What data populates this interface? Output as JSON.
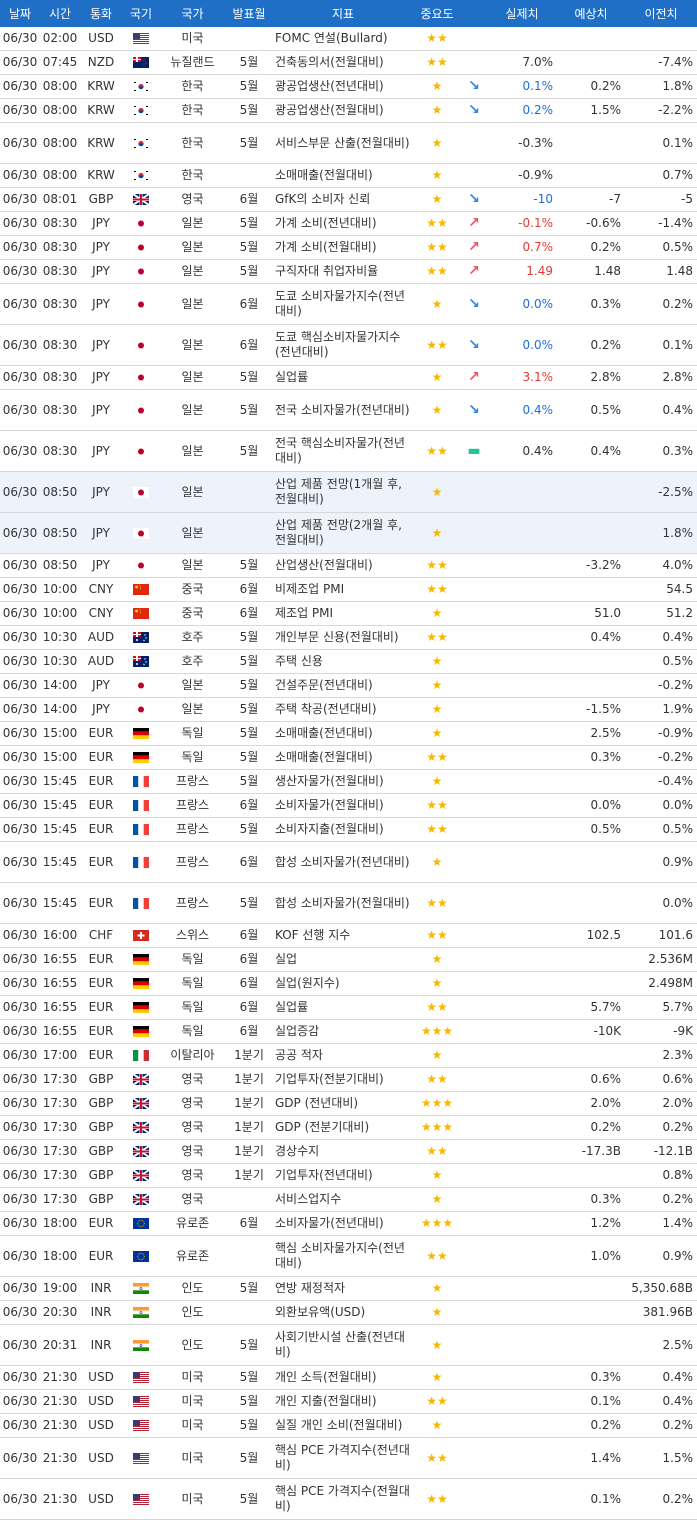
{
  "columns": [
    "날짜",
    "시간",
    "통화",
    "국기",
    "국가",
    "발표월",
    "지표",
    "중요도",
    "",
    "실제치",
    "예상치",
    "이전치"
  ],
  "flag_colors": {
    "US": "#b22234",
    "NZ": "#012169",
    "KR": "#ffffff",
    "GB": "#012169",
    "JP": "#ffffff",
    "CN": "#de2910",
    "AU": "#012169",
    "DE": "#000000",
    "FR": "#0055a4",
    "CH": "#d52b1e",
    "IT": "#009246",
    "EU": "#003399",
    "IN": "#ff9933"
  },
  "rows": [
    {
      "date": "06/30",
      "time": "02:00",
      "cur": "USD",
      "flag": "US",
      "country": "미국",
      "month": "",
      "indicator": "FOMC 연설(Bullard)",
      "stars": "★★",
      "trend": "",
      "actual": "",
      "forecast": "",
      "previous": ""
    },
    {
      "date": "06/30",
      "time": "07:45",
      "cur": "NZD",
      "flag": "NZ",
      "country": "뉴질랜드",
      "month": "5월",
      "indicator": "건축동의서(전월대비)",
      "stars": "★★",
      "trend": "",
      "actual": "7.0%",
      "forecast": "",
      "previous": "-7.4%"
    },
    {
      "date": "06/30",
      "time": "08:00",
      "cur": "KRW",
      "flag": "KR",
      "country": "한국",
      "month": "5월",
      "indicator": "광공업생산(전년대비)",
      "stars": "★",
      "trend": "dn",
      "actual": "0.1%",
      "forecast": "0.2%",
      "previous": "1.8%"
    },
    {
      "date": "06/30",
      "time": "08:00",
      "cur": "KRW",
      "flag": "KR",
      "country": "한국",
      "month": "5월",
      "indicator": "광공업생산(전월대비)",
      "stars": "★",
      "trend": "dn",
      "actual": "0.2%",
      "forecast": "1.5%",
      "previous": "-2.2%"
    },
    {
      "date": "06/30",
      "time": "08:00",
      "cur": "KRW",
      "flag": "KR",
      "country": "한국",
      "month": "5월",
      "indicator": "서비스부문 산출(전월대비)",
      "stars": "★",
      "trend": "",
      "actual": "-0.3%",
      "forecast": "",
      "previous": "0.1%"
    },
    {
      "date": "06/30",
      "time": "08:00",
      "cur": "KRW",
      "flag": "KR",
      "country": "한국",
      "month": "",
      "indicator": "소매매출(전월대비)",
      "stars": "★",
      "trend": "",
      "actual": "-0.9%",
      "forecast": "",
      "previous": "0.7%"
    },
    {
      "date": "06/30",
      "time": "08:01",
      "cur": "GBP",
      "flag": "GB",
      "country": "영국",
      "month": "6월",
      "indicator": "GfK의 소비자 신뢰",
      "stars": "★",
      "trend": "dn",
      "actual": "-10",
      "forecast": "-7",
      "previous": "-5"
    },
    {
      "date": "06/30",
      "time": "08:30",
      "cur": "JPY",
      "flag": "JP",
      "country": "일본",
      "month": "5월",
      "indicator": "가계 소비(전년대비)",
      "stars": "★★",
      "trend": "up",
      "actual": "-0.1%",
      "forecast": "-0.6%",
      "previous": "-1.4%"
    },
    {
      "date": "06/30",
      "time": "08:30",
      "cur": "JPY",
      "flag": "JP",
      "country": "일본",
      "month": "5월",
      "indicator": "가계 소비(전월대비)",
      "stars": "★★",
      "trend": "up",
      "actual": "0.7%",
      "forecast": "0.2%",
      "previous": "0.5%"
    },
    {
      "date": "06/30",
      "time": "08:30",
      "cur": "JPY",
      "flag": "JP",
      "country": "일본",
      "month": "5월",
      "indicator": "구직자대 취업자비율",
      "stars": "★★",
      "trend": "up",
      "actual": "1.49",
      "forecast": "1.48",
      "previous": "1.48"
    },
    {
      "date": "06/30",
      "time": "08:30",
      "cur": "JPY",
      "flag": "JP",
      "country": "일본",
      "month": "6월",
      "indicator": "도쿄 소비자물가지수(전년대비)",
      "stars": "★",
      "trend": "dn",
      "actual": "0.0%",
      "forecast": "0.3%",
      "previous": "0.2%"
    },
    {
      "date": "06/30",
      "time": "08:30",
      "cur": "JPY",
      "flag": "JP",
      "country": "일본",
      "month": "6월",
      "indicator": "도쿄 핵심소비자물가지수(전년대비)",
      "stars": "★★",
      "trend": "dn",
      "actual": "0.0%",
      "forecast": "0.2%",
      "previous": "0.1%"
    },
    {
      "date": "06/30",
      "time": "08:30",
      "cur": "JPY",
      "flag": "JP",
      "country": "일본",
      "month": "5월",
      "indicator": "실업률",
      "stars": "★",
      "trend": "up",
      "actual": "3.1%",
      "forecast": "2.8%",
      "previous": "2.8%"
    },
    {
      "date": "06/30",
      "time": "08:30",
      "cur": "JPY",
      "flag": "JP",
      "country": "일본",
      "month": "5월",
      "indicator": "전국 소비자물가(전년대비)",
      "stars": "★",
      "trend": "dn",
      "actual": "0.4%",
      "forecast": "0.5%",
      "previous": "0.4%"
    },
    {
      "date": "06/30",
      "time": "08:30",
      "cur": "JPY",
      "flag": "JP",
      "country": "일본",
      "month": "5월",
      "indicator": "전국 핵심소비자물가(전년대비)",
      "stars": "★★",
      "trend": "eq",
      "actual": "0.4%",
      "forecast": "0.4%",
      "previous": "0.3%"
    },
    {
      "date": "06/30",
      "time": "08:50",
      "cur": "JPY",
      "flag": "JP",
      "country": "일본",
      "month": "",
      "indicator": "산업 제품 전망(1개월 후, 전월대비)",
      "stars": "★",
      "trend": "",
      "actual": "",
      "forecast": "",
      "previous": "-2.5%"
    },
    {
      "date": "06/30",
      "time": "08:50",
      "cur": "JPY",
      "flag": "JP",
      "country": "일본",
      "month": "",
      "indicator": "산업 제품 전망(2개월 후, 전월대비)",
      "stars": "★",
      "trend": "",
      "actual": "",
      "forecast": "",
      "previous": "1.8%"
    },
    {
      "date": "06/30",
      "time": "08:50",
      "cur": "JPY",
      "flag": "JP",
      "country": "일본",
      "month": "5월",
      "indicator": "산업생산(전월대비)",
      "stars": "★★",
      "trend": "",
      "actual": "",
      "forecast": "-3.2%",
      "previous": "4.0%"
    },
    {
      "date": "06/30",
      "time": "10:00",
      "cur": "CNY",
      "flag": "CN",
      "country": "중국",
      "month": "6월",
      "indicator": "비제조업 PMI",
      "stars": "★★",
      "trend": "",
      "actual": "",
      "forecast": "",
      "previous": "54.5"
    },
    {
      "date": "06/30",
      "time": "10:00",
      "cur": "CNY",
      "flag": "CN",
      "country": "중국",
      "month": "6월",
      "indicator": "제조업 PMI",
      "stars": "★",
      "trend": "",
      "actual": "",
      "forecast": "51.0",
      "previous": "51.2"
    },
    {
      "date": "06/30",
      "time": "10:30",
      "cur": "AUD",
      "flag": "AU",
      "country": "호주",
      "month": "5월",
      "indicator": "개인부문 신용(전월대비)",
      "stars": "★★",
      "trend": "",
      "actual": "",
      "forecast": "0.4%",
      "previous": "0.4%"
    },
    {
      "date": "06/30",
      "time": "10:30",
      "cur": "AUD",
      "flag": "AU",
      "country": "호주",
      "month": "5월",
      "indicator": "주택 신용",
      "stars": "★",
      "trend": "",
      "actual": "",
      "forecast": "",
      "previous": "0.5%"
    },
    {
      "date": "06/30",
      "time": "14:00",
      "cur": "JPY",
      "flag": "JP",
      "country": "일본",
      "month": "5월",
      "indicator": "건설주문(전년대비)",
      "stars": "★",
      "trend": "",
      "actual": "",
      "forecast": "",
      "previous": "-0.2%"
    },
    {
      "date": "06/30",
      "time": "14:00",
      "cur": "JPY",
      "flag": "JP",
      "country": "일본",
      "month": "5월",
      "indicator": "주택 착공(전년대비)",
      "stars": "★",
      "trend": "",
      "actual": "",
      "forecast": "-1.5%",
      "previous": "1.9%"
    },
    {
      "date": "06/30",
      "time": "15:00",
      "cur": "EUR",
      "flag": "DE",
      "country": "독일",
      "month": "5월",
      "indicator": "소매매출(전년대비)",
      "stars": "★",
      "trend": "",
      "actual": "",
      "forecast": "2.5%",
      "previous": "-0.9%"
    },
    {
      "date": "06/30",
      "time": "15:00",
      "cur": "EUR",
      "flag": "DE",
      "country": "독일",
      "month": "5월",
      "indicator": "소매매출(전월대비)",
      "stars": "★★",
      "trend": "",
      "actual": "",
      "forecast": "0.3%",
      "previous": "-0.2%"
    },
    {
      "date": "06/30",
      "time": "15:45",
      "cur": "EUR",
      "flag": "FR",
      "country": "프랑스",
      "month": "5월",
      "indicator": "생산자물가(전월대비)",
      "stars": "★",
      "trend": "",
      "actual": "",
      "forecast": "",
      "previous": "-0.4%"
    },
    {
      "date": "06/30",
      "time": "15:45",
      "cur": "EUR",
      "flag": "FR",
      "country": "프랑스",
      "month": "6월",
      "indicator": "소비자물가(전월대비)",
      "stars": "★★",
      "trend": "",
      "actual": "",
      "forecast": "0.0%",
      "previous": "0.0%"
    },
    {
      "date": "06/30",
      "time": "15:45",
      "cur": "EUR",
      "flag": "FR",
      "country": "프랑스",
      "month": "5월",
      "indicator": "소비자지출(전월대비)",
      "stars": "★★",
      "trend": "",
      "actual": "",
      "forecast": "0.5%",
      "previous": "0.5%"
    },
    {
      "date": "06/30",
      "time": "15:45",
      "cur": "EUR",
      "flag": "FR",
      "country": "프랑스",
      "month": "6월",
      "indicator": "합성 소비자물가(전년대비)",
      "stars": "★",
      "trend": "",
      "actual": "",
      "forecast": "",
      "previous": "0.9%"
    },
    {
      "date": "06/30",
      "time": "15:45",
      "cur": "EUR",
      "flag": "FR",
      "country": "프랑스",
      "month": "5월",
      "indicator": "합성 소비자물가(전월대비)",
      "stars": "★★",
      "trend": "",
      "actual": "",
      "forecast": "",
      "previous": "0.0%"
    },
    {
      "date": "06/30",
      "time": "16:00",
      "cur": "CHF",
      "flag": "CH",
      "country": "스위스",
      "month": "6월",
      "indicator": "KOF 선행 지수",
      "stars": "★★",
      "trend": "",
      "actual": "",
      "forecast": "102.5",
      "previous": "101.6"
    },
    {
      "date": "06/30",
      "time": "16:55",
      "cur": "EUR",
      "flag": "DE",
      "country": "독일",
      "month": "6월",
      "indicator": "실업",
      "stars": "★",
      "trend": "",
      "actual": "",
      "forecast": "",
      "previous": "2.536M"
    },
    {
      "date": "06/30",
      "time": "16:55",
      "cur": "EUR",
      "flag": "DE",
      "country": "독일",
      "month": "6월",
      "indicator": "실업(원지수)",
      "stars": "★",
      "trend": "",
      "actual": "",
      "forecast": "",
      "previous": "2.498M"
    },
    {
      "date": "06/30",
      "time": "16:55",
      "cur": "EUR",
      "flag": "DE",
      "country": "독일",
      "month": "6월",
      "indicator": "실업률",
      "stars": "★★",
      "trend": "",
      "actual": "",
      "forecast": "5.7%",
      "previous": "5.7%"
    },
    {
      "date": "06/30",
      "time": "16:55",
      "cur": "EUR",
      "flag": "DE",
      "country": "독일",
      "month": "6월",
      "indicator": "실업증감",
      "stars": "★★★",
      "trend": "",
      "actual": "",
      "forecast": "-10K",
      "previous": "-9K"
    },
    {
      "date": "06/30",
      "time": "17:00",
      "cur": "EUR",
      "flag": "IT",
      "country": "이탈리아",
      "month": "1분기",
      "indicator": "공공 적자",
      "stars": "★",
      "trend": "",
      "actual": "",
      "forecast": "",
      "previous": "2.3%"
    },
    {
      "date": "06/30",
      "time": "17:30",
      "cur": "GBP",
      "flag": "GB",
      "country": "영국",
      "month": "1분기",
      "indicator": "기업투자(전분기대비)",
      "stars": "★★",
      "trend": "",
      "actual": "",
      "forecast": "0.6%",
      "previous": "0.6%"
    },
    {
      "date": "06/30",
      "time": "17:30",
      "cur": "GBP",
      "flag": "GB",
      "country": "영국",
      "month": "1분기",
      "indicator": "GDP (전년대비)",
      "stars": "★★★",
      "trend": "",
      "actual": "",
      "forecast": "2.0%",
      "previous": "2.0%"
    },
    {
      "date": "06/30",
      "time": "17:30",
      "cur": "GBP",
      "flag": "GB",
      "country": "영국",
      "month": "1분기",
      "indicator": "GDP (전분기대비)",
      "stars": "★★★",
      "trend": "",
      "actual": "",
      "forecast": "0.2%",
      "previous": "0.2%"
    },
    {
      "date": "06/30",
      "time": "17:30",
      "cur": "GBP",
      "flag": "GB",
      "country": "영국",
      "month": "1분기",
      "indicator": "경상수지",
      "stars": "★★",
      "trend": "",
      "actual": "",
      "forecast": "-17.3B",
      "previous": "-12.1B"
    },
    {
      "date": "06/30",
      "time": "17:30",
      "cur": "GBP",
      "flag": "GB",
      "country": "영국",
      "month": "1분기",
      "indicator": "기업투자(전년대비)",
      "stars": "★",
      "trend": "",
      "actual": "",
      "forecast": "",
      "previous": "0.8%"
    },
    {
      "date": "06/30",
      "time": "17:30",
      "cur": "GBP",
      "flag": "GB",
      "country": "영국",
      "month": "",
      "indicator": "서비스업지수",
      "stars": "★",
      "trend": "",
      "actual": "",
      "forecast": "0.3%",
      "previous": "0.2%"
    },
    {
      "date": "06/30",
      "time": "18:00",
      "cur": "EUR",
      "flag": "EU",
      "country": "유로존",
      "month": "6월",
      "indicator": "소비자물가(전년대비)",
      "stars": "★★★",
      "trend": "",
      "actual": "",
      "forecast": "1.2%",
      "previous": "1.4%"
    },
    {
      "date": "06/30",
      "time": "18:00",
      "cur": "EUR",
      "flag": "EU",
      "country": "유로존",
      "month": "",
      "indicator": "핵심 소비자물가지수(전년대비)",
      "stars": "★★",
      "trend": "",
      "actual": "",
      "forecast": "1.0%",
      "previous": "0.9%"
    },
    {
      "date": "06/30",
      "time": "19:00",
      "cur": "INR",
      "flag": "IN",
      "country": "인도",
      "month": "5월",
      "indicator": "연방 재정적자",
      "stars": "★",
      "trend": "",
      "actual": "",
      "forecast": "",
      "previous": "5,350.68B"
    },
    {
      "date": "06/30",
      "time": "20:30",
      "cur": "INR",
      "flag": "IN",
      "country": "인도",
      "month": "",
      "indicator": "외환보유액(USD)",
      "stars": "★",
      "trend": "",
      "actual": "",
      "forecast": "",
      "previous": "381.96B"
    },
    {
      "date": "06/30",
      "time": "20:31",
      "cur": "INR",
      "flag": "IN",
      "country": "인도",
      "month": "5월",
      "indicator": "사회기반시설 산출(전년대비)",
      "stars": "★",
      "trend": "",
      "actual": "",
      "forecast": "",
      "previous": "2.5%"
    },
    {
      "date": "06/30",
      "time": "21:30",
      "cur": "USD",
      "flag": "US",
      "country": "미국",
      "month": "5월",
      "indicator": "개인 소득(전월대비)",
      "stars": "★",
      "trend": "",
      "actual": "",
      "forecast": "0.3%",
      "previous": "0.4%"
    },
    {
      "date": "06/30",
      "time": "21:30",
      "cur": "USD",
      "flag": "US",
      "country": "미국",
      "month": "5월",
      "indicator": "개인 지출(전월대비)",
      "stars": "★★",
      "trend": "",
      "actual": "",
      "forecast": "0.1%",
      "previous": "0.4%"
    },
    {
      "date": "06/30",
      "time": "21:30",
      "cur": "USD",
      "flag": "US",
      "country": "미국",
      "month": "5월",
      "indicator": "실질 개인 소비(전월대비)",
      "stars": "★",
      "trend": "",
      "actual": "",
      "forecast": "0.2%",
      "previous": "0.2%"
    },
    {
      "date": "06/30",
      "time": "21:30",
      "cur": "USD",
      "flag": "US",
      "country": "미국",
      "month": "5월",
      "indicator": "핵심 PCE 가격지수(전년대비)",
      "stars": "★★",
      "trend": "",
      "actual": "",
      "forecast": "1.4%",
      "previous": "1.5%"
    },
    {
      "date": "06/30",
      "time": "21:30",
      "cur": "USD",
      "flag": "US",
      "country": "미국",
      "month": "5월",
      "indicator": "핵심 PCE 가격지수(전월대비)",
      "stars": "★★",
      "trend": "",
      "actual": "",
      "forecast": "0.1%",
      "previous": "0.2%"
    }
  ]
}
